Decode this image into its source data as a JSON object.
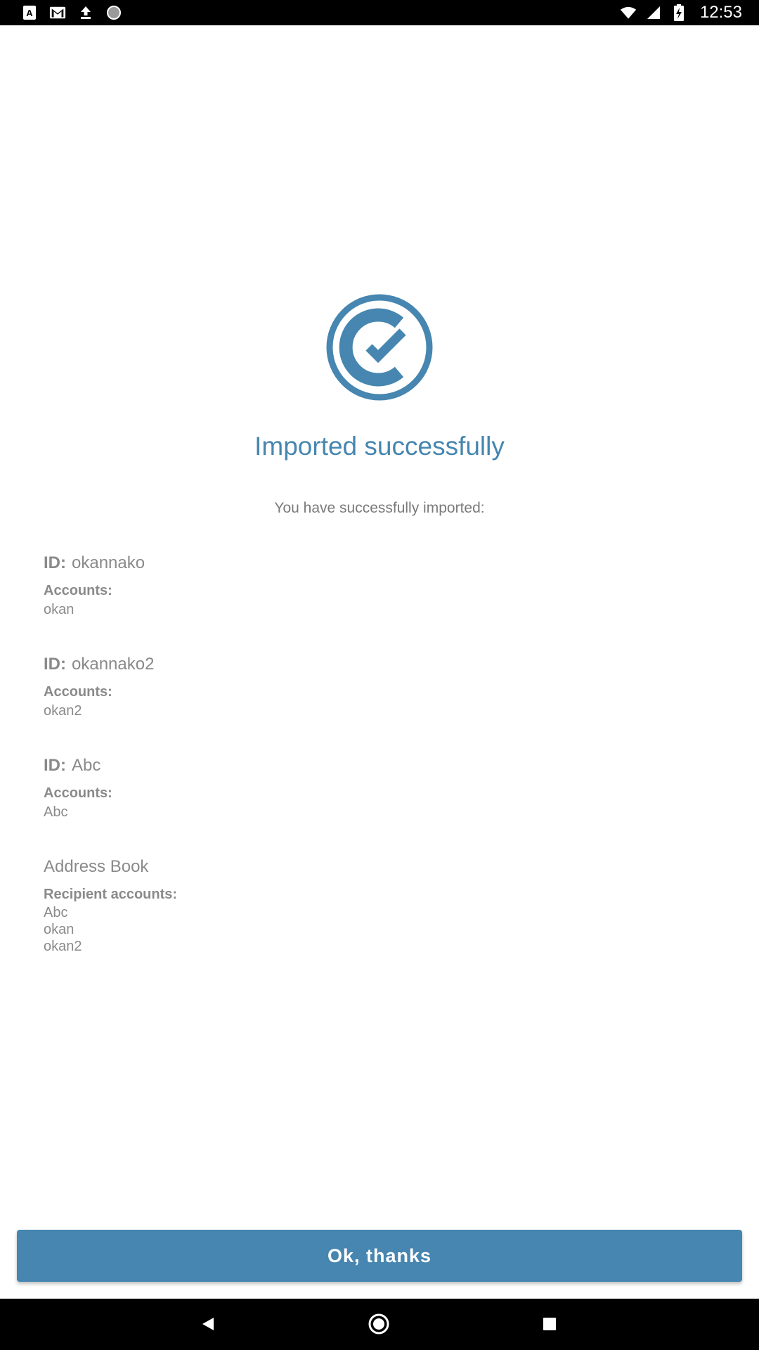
{
  "status_bar": {
    "time": "12:53",
    "left_icons": [
      "a-badge-icon",
      "gmail-icon",
      "upload-icon",
      "circle-dot-icon"
    ],
    "right_icons": [
      "wifi-icon",
      "cell-signal-icon",
      "battery-charging-icon"
    ]
  },
  "main": {
    "icon": "check-circle-icon",
    "title": "Imported successfully",
    "subtitle": "You have successfully imported:",
    "records": [
      {
        "id_prefix": "ID:",
        "id": "okannako",
        "accounts_label": "Accounts:",
        "accounts": [
          "okan"
        ]
      },
      {
        "id_prefix": "ID:",
        "id": "okannako2",
        "accounts_label": "Accounts:",
        "accounts": [
          "okan2"
        ]
      },
      {
        "id_prefix": "ID:",
        "id": "Abc",
        "accounts_label": "Accounts:",
        "accounts": [
          "Abc"
        ]
      }
    ],
    "address_book": {
      "title": "Address Book",
      "recipients_label": "Recipient accounts:",
      "recipients": [
        "Abc",
        "okan",
        "okan2"
      ]
    }
  },
  "button": {
    "label": "Ok, thanks"
  },
  "nav_bar": {
    "icons": [
      "back-icon",
      "home-icon",
      "recents-icon"
    ]
  },
  "colors": {
    "accent": "#4686b0",
    "text_muted": "#8a8a8a"
  }
}
